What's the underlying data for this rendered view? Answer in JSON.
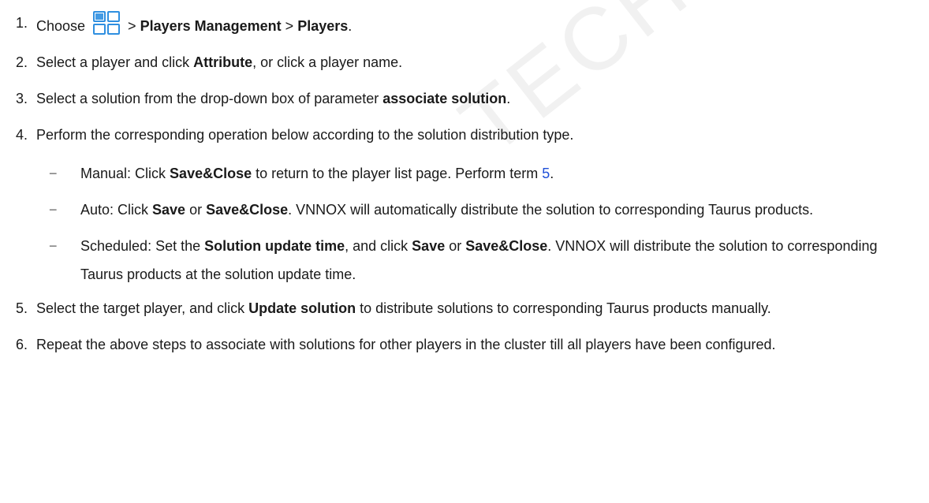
{
  "watermark": "TECH CO., LTD",
  "steps": [
    {
      "num": "1.",
      "pre": "Choose",
      "icon": "grid-tiles-icon",
      "sep1": ">",
      "b1": "Players Management",
      "sep2": ">",
      "b2": "Players",
      "end": "."
    },
    {
      "num": "2.",
      "t1": "Select a player and click ",
      "b1": "Attribute",
      "t2": ", or click a player name."
    },
    {
      "num": "3.",
      "t1": "Select a solution from the drop-down box of parameter ",
      "b1": "associate solution",
      "t2": "."
    },
    {
      "num": "4.",
      "text": "Perform the corresponding operation below according to the solution distribution type.",
      "subs": [
        {
          "dash": "−",
          "t1": "Manual: Click ",
          "b1": "Save&Close",
          "t2": " to return to the player list page. Perform term ",
          "link": "5",
          "t3": "."
        },
        {
          "dash": "−",
          "t1": "Auto: Click ",
          "b1": "Save",
          "t2": " or ",
          "b2": "Save&Close",
          "t3": ". VNNOX will automatically distribute the solution to corresponding Taurus products."
        },
        {
          "dash": "−",
          "t1": "Scheduled: Set the ",
          "b1": "Solution update time",
          "t2": ", and click ",
          "b2": "Save",
          "t3": " or ",
          "b3": "Save&Close",
          "t4": ". VNNOX will distribute the solution to corresponding Taurus products at the solution update time."
        }
      ]
    },
    {
      "num": "5.",
      "t1": "Select the target player, and click ",
      "b1": "Update solution",
      "t2": " to distribute solutions to corresponding Taurus products manually."
    },
    {
      "num": "6.",
      "text": "Repeat the above steps to associate with solutions for other players in the cluster till all players have been configured."
    }
  ],
  "colors": {
    "icon_blue": "#2f8fe0",
    "link": "#1f4fd8",
    "watermark": "#f1f1f1"
  }
}
